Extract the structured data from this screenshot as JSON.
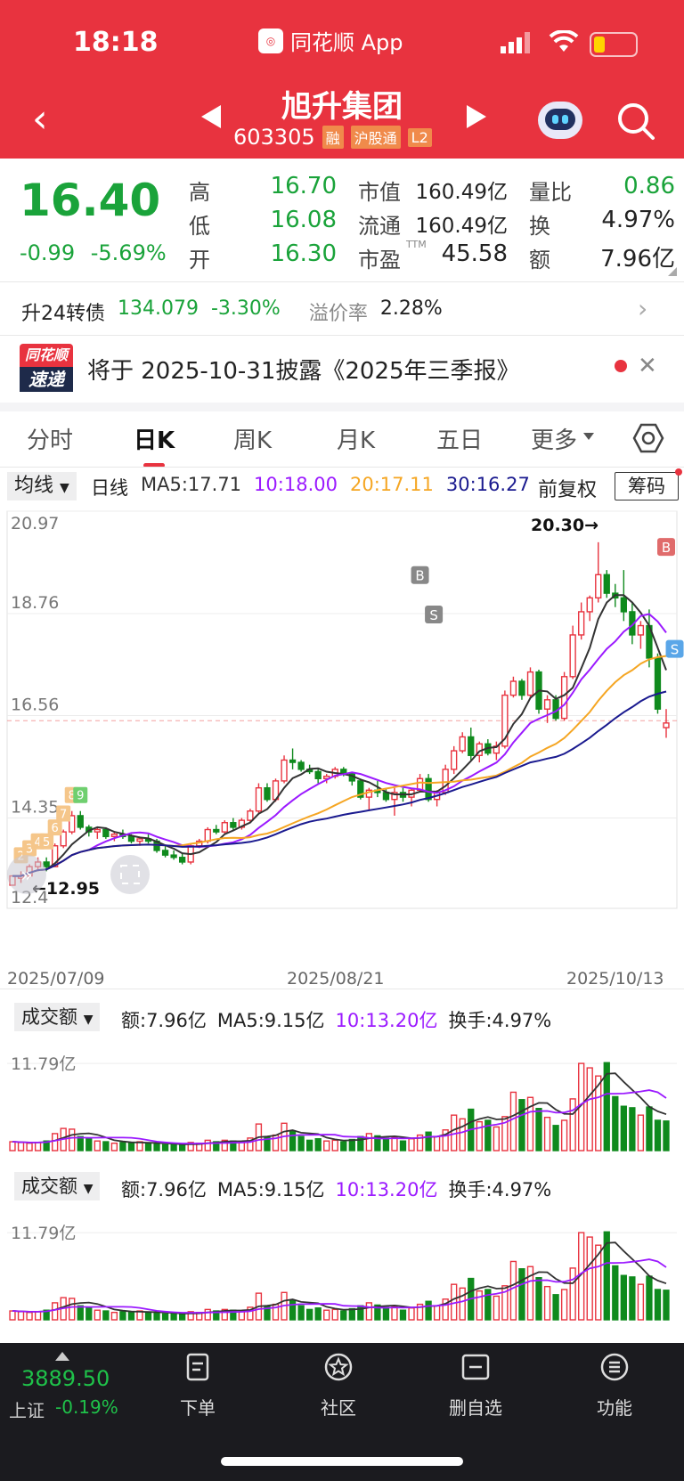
{
  "status": {
    "time": "18:18",
    "app": "同花顺 App"
  },
  "header": {
    "title": "旭升集团",
    "code": "603305",
    "tags": [
      "融",
      "沪股通",
      "L2"
    ]
  },
  "quote": {
    "price": "16.40",
    "change": "-0.99",
    "change_pct": "-5.69%",
    "rows": [
      {
        "l1": "高",
        "v1": "16.70",
        "l2": "市值",
        "v2": "160.49亿",
        "l3": "量比",
        "v3": "0.86"
      },
      {
        "l1": "低",
        "v1": "16.08",
        "l2": "流通",
        "v2": "160.49亿",
        "l3": "换",
        "v3": "4.97%"
      },
      {
        "l1": "开",
        "v1": "16.30",
        "l2": "市盈",
        "v2": "45.58",
        "l3": "额",
        "v3": "7.96亿"
      }
    ],
    "pe_sup": "TTM"
  },
  "bond": {
    "name": "升24转债",
    "price": "134.079",
    "chg": "-3.30%",
    "prem_label": "溢价率",
    "prem": "2.28%"
  },
  "news": {
    "logo_top": "同花顺",
    "logo_bottom": "速递",
    "text": "将于 2025-10-31披露《2025年三季报》"
  },
  "tabs": [
    "分时",
    "日K",
    "周K",
    "月K",
    "五日",
    "更多"
  ],
  "ma_bar": {
    "selector": "均线",
    "period": "日线",
    "ma5": "MA5:17.71",
    "ma10": "10:18.00",
    "ma20": "20:17.11",
    "ma30": "30:16.27",
    "adjust": "前复权",
    "chips": "筹码"
  },
  "kchart": {
    "y_labels": [
      "20.97",
      "18.76",
      "16.56",
      "14.35",
      "12.4"
    ],
    "high_label": "20.30→",
    "low_label": "←12.95",
    "dates": [
      "2025/07/09",
      "2025/08/21",
      "2025/10/13"
    ],
    "signals": [
      "B",
      "S",
      "B",
      "S"
    ],
    "td_counts": [
      "2",
      "3",
      "4",
      "5",
      "6",
      "7",
      "8",
      "9"
    ]
  },
  "colors": {
    "up": "#e8333f",
    "down": "#0f8a1d",
    "ma5": "#333333",
    "ma10": "#9b1aff",
    "ma20": "#f5a623",
    "ma30": "#1a1a8f"
  },
  "chart_data": [
    {
      "type": "candlestick",
      "title": "日K",
      "x_start": "2025/07/09",
      "x_mid": "2025/08/21",
      "x_end": "2025/10/13",
      "ylim": [
        12.4,
        20.97
      ],
      "yticks": [
        20.97,
        18.76,
        16.56,
        14.35
      ],
      "max": 20.3,
      "min": 12.95,
      "ohlc": [
        [
          12.9,
          13.1,
          12.9,
          13.1
        ],
        [
          13.05,
          13.2,
          12.95,
          13.1
        ],
        [
          13.1,
          13.35,
          13.05,
          13.3
        ],
        [
          13.3,
          13.5,
          13.2,
          13.4
        ],
        [
          13.4,
          13.5,
          13.2,
          13.3
        ],
        [
          13.3,
          13.8,
          13.3,
          13.75
        ],
        [
          13.75,
          14.1,
          13.7,
          14.05
        ],
        [
          14.05,
          14.5,
          14.0,
          14.4
        ],
        [
          14.4,
          14.5,
          14.1,
          14.15
        ],
        [
          14.15,
          14.2,
          13.95,
          14.05
        ],
        [
          14.05,
          14.15,
          13.9,
          14.1
        ],
        [
          14.1,
          14.15,
          13.9,
          13.95
        ],
        [
          13.95,
          14.05,
          13.85,
          14.0
        ],
        [
          14.0,
          14.1,
          13.9,
          13.95
        ],
        [
          13.95,
          14.0,
          13.8,
          13.85
        ],
        [
          13.85,
          13.95,
          13.75,
          13.9
        ],
        [
          13.9,
          14.0,
          13.8,
          13.85
        ],
        [
          13.85,
          13.9,
          13.6,
          13.65
        ],
        [
          13.65,
          13.75,
          13.5,
          13.55
        ],
        [
          13.55,
          13.65,
          13.45,
          13.5
        ],
        [
          13.5,
          13.6,
          13.35,
          13.4
        ],
        [
          13.4,
          13.8,
          13.35,
          13.75
        ],
        [
          13.75,
          13.9,
          13.7,
          13.85
        ],
        [
          13.85,
          14.15,
          13.8,
          14.1
        ],
        [
          14.1,
          14.2,
          14.0,
          14.05
        ],
        [
          14.05,
          14.3,
          14.0,
          14.25
        ],
        [
          14.25,
          14.35,
          14.1,
          14.15
        ],
        [
          14.15,
          14.35,
          14.1,
          14.3
        ],
        [
          14.3,
          14.55,
          14.25,
          14.5
        ],
        [
          14.5,
          15.1,
          14.45,
          15.0
        ],
        [
          15.0,
          15.1,
          14.7,
          14.75
        ],
        [
          14.75,
          15.2,
          14.7,
          15.15
        ],
        [
          15.15,
          15.7,
          15.1,
          15.6
        ],
        [
          15.6,
          15.85,
          15.4,
          15.55
        ],
        [
          15.55,
          15.6,
          15.35,
          15.4
        ],
        [
          15.4,
          15.5,
          15.3,
          15.35
        ],
        [
          15.35,
          15.4,
          15.1,
          15.2
        ],
        [
          15.2,
          15.3,
          15.1,
          15.25
        ],
        [
          15.25,
          15.45,
          15.2,
          15.4
        ],
        [
          15.4,
          15.45,
          15.25,
          15.3
        ],
        [
          15.3,
          15.35,
          15.05,
          15.15
        ],
        [
          15.15,
          15.2,
          14.75,
          14.8
        ],
        [
          14.8,
          15.0,
          14.5,
          14.95
        ],
        [
          14.95,
          15.15,
          14.8,
          14.9
        ],
        [
          14.9,
          15.0,
          14.7,
          14.75
        ],
        [
          14.75,
          15.0,
          14.4,
          14.9
        ],
        [
          14.9,
          15.0,
          14.7,
          14.8
        ],
        [
          14.8,
          15.0,
          14.6,
          14.95
        ],
        [
          14.95,
          15.3,
          14.9,
          15.2
        ],
        [
          15.2,
          15.3,
          14.7,
          14.75
        ],
        [
          14.75,
          14.95,
          14.6,
          14.9
        ],
        [
          14.9,
          15.5,
          14.85,
          15.4
        ],
        [
          15.4,
          15.9,
          15.3,
          15.8
        ],
        [
          15.8,
          16.2,
          15.75,
          16.1
        ],
        [
          16.1,
          16.3,
          15.6,
          15.7
        ],
        [
          15.7,
          16.0,
          15.55,
          15.95
        ],
        [
          15.95,
          16.05,
          15.7,
          15.75
        ],
        [
          15.75,
          16.0,
          15.6,
          15.9
        ],
        [
          15.9,
          17.1,
          15.85,
          17.0
        ],
        [
          17.0,
          17.4,
          16.95,
          17.3
        ],
        [
          17.3,
          17.35,
          16.9,
          17.0
        ],
        [
          17.0,
          17.6,
          16.95,
          17.5
        ],
        [
          17.5,
          17.55,
          16.6,
          16.7
        ],
        [
          16.7,
          17.0,
          16.4,
          16.9
        ],
        [
          16.9,
          17.0,
          16.45,
          16.5
        ],
        [
          16.5,
          17.5,
          16.45,
          17.4
        ],
        [
          17.4,
          18.5,
          17.35,
          18.3
        ],
        [
          18.3,
          19.0,
          18.2,
          18.8
        ],
        [
          18.8,
          19.15,
          18.6,
          19.1
        ],
        [
          19.1,
          20.3,
          19.0,
          19.6
        ],
        [
          19.6,
          19.7,
          19.1,
          19.2
        ],
        [
          19.2,
          19.4,
          18.9,
          19.1
        ],
        [
          19.1,
          19.7,
          18.6,
          18.8
        ],
        [
          18.8,
          19.0,
          18.1,
          18.3
        ],
        [
          18.3,
          18.6,
          18.0,
          18.5
        ],
        [
          18.5,
          18.85,
          17.6,
          17.8
        ],
        [
          17.8,
          17.9,
          16.6,
          16.7
        ],
        [
          16.3,
          16.7,
          16.08,
          16.4
        ]
      ],
      "ma": {
        "ma5": 17.71,
        "ma10": 18.0,
        "ma20": 17.11,
        "ma30": 16.27
      }
    },
    {
      "type": "bar",
      "title": "成交额",
      "amount": "额:7.96亿",
      "ma5": "MA5:9.15亿",
      "ma10": "10:13.20亿",
      "turnover": "换手:4.97%",
      "ytick": "11.79亿",
      "values": [
        1.2,
        1.1,
        1.0,
        1.1,
        1.3,
        2.3,
        3.0,
        2.9,
        1.9,
        1.6,
        1.3,
        1.2,
        1.0,
        1.1,
        1.0,
        1.2,
        1.0,
        0.9,
        0.8,
        0.8,
        0.7,
        1.1,
        1.0,
        1.4,
        1.2,
        1.4,
        1.3,
        1.1,
        1.7,
        3.6,
        1.8,
        2.1,
        3.7,
        2.6,
        1.9,
        1.4,
        1.6,
        1.3,
        1.4,
        1.2,
        1.5,
        1.9,
        2.3,
        2.0,
        1.7,
        1.8,
        1.3,
        1.6,
        2.1,
        2.5,
        1.9,
        2.8,
        4.8,
        4.3,
        5.6,
        3.9,
        4.1,
        3.2,
        4.6,
        7.9,
        6.9,
        7.2,
        5.7,
        4.5,
        3.4,
        4.1,
        7.0,
        11.8,
        11.2,
        10.1,
        11.9,
        7.3,
        6.0,
        5.8,
        4.8,
        5.9,
        4.1,
        4.0
      ],
      "up": [
        true,
        true,
        true,
        true,
        false,
        true,
        true,
        true,
        false,
        false,
        true,
        false,
        true,
        false,
        false,
        true,
        false,
        false,
        false,
        false,
        false,
        true,
        true,
        true,
        false,
        true,
        false,
        true,
        true,
        true,
        false,
        true,
        true,
        false,
        false,
        false,
        false,
        true,
        true,
        false,
        false,
        false,
        true,
        false,
        false,
        true,
        false,
        true,
        true,
        false,
        true,
        true,
        true,
        true,
        false,
        true,
        false,
        true,
        true,
        true,
        false,
        true,
        false,
        true,
        false,
        true,
        true,
        true,
        true,
        true,
        false,
        false,
        false,
        false,
        true,
        false,
        false,
        false
      ],
      "ylim": [
        0,
        13.5
      ]
    }
  ],
  "volume_panels": [
    {
      "selector": "成交额",
      "amount": "额:7.96亿",
      "ma5": "MA5:9.15亿",
      "ma10": "10:13.20亿",
      "turnover": "换手:4.97%",
      "ytick": "11.79亿"
    },
    {
      "selector": "成交额",
      "amount": "额:7.96亿",
      "ma5": "MA5:9.15亿",
      "ma10": "10:13.20亿",
      "turnover": "换手:4.97%",
      "ytick": "11.79亿"
    }
  ],
  "bottom": {
    "index_value": "3889.50",
    "index_name": "上证",
    "index_chg": "-0.19%",
    "nav": [
      "下单",
      "社区",
      "删自选",
      "功能"
    ]
  }
}
